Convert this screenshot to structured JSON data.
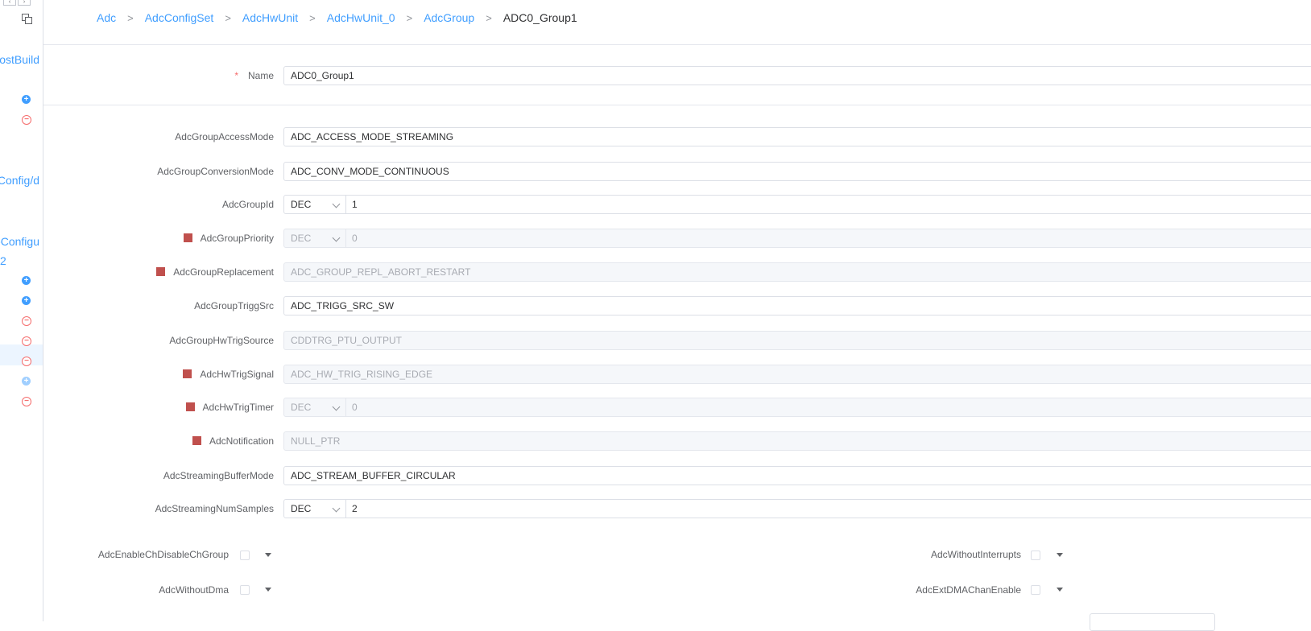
{
  "sidebar": {
    "items": [
      {
        "text": "ostBuild"
      },
      {
        "text": "Config/d"
      },
      {
        "text": "eConfigu"
      },
      {
        "text": "2"
      }
    ]
  },
  "breadcrumb": [
    "Adc",
    "AdcConfigSet",
    "AdcHwUnit",
    "AdcHwUnit_0",
    "AdcGroup",
    "ADC0_Group1"
  ],
  "breadcrumb_separator": ">",
  "form": {
    "name": {
      "label": "Name",
      "required_mark": "*",
      "value": "ADC0_Group1"
    },
    "access_mode": {
      "label": "AdcGroupAccessMode",
      "value": "ADC_ACCESS_MODE_STREAMING"
    },
    "conversion_mode": {
      "label": "AdcGroupConversionMode",
      "value": "ADC_CONV_MODE_CONTINUOUS"
    },
    "group_id": {
      "label": "AdcGroupId",
      "base": "DEC",
      "value": "1"
    },
    "group_priority": {
      "label": "AdcGroupPriority",
      "base": "DEC",
      "value": "0"
    },
    "group_replacement": {
      "label": "AdcGroupReplacement",
      "value": "ADC_GROUP_REPL_ABORT_RESTART"
    },
    "trigg_src": {
      "label": "AdcGroupTriggSrc",
      "value": "ADC_TRIGG_SRC_SW"
    },
    "hw_trig_source": {
      "label": "AdcGroupHwTrigSource",
      "value": "CDDTRG_PTU_OUTPUT"
    },
    "hw_trig_signal": {
      "label": "AdcHwTrigSignal",
      "value": "ADC_HW_TRIG_RISING_EDGE"
    },
    "hw_trig_timer": {
      "label": "AdcHwTrigTimer",
      "base": "DEC",
      "value": "0"
    },
    "notification": {
      "label": "AdcNotification",
      "value": "NULL_PTR"
    },
    "streaming_buffer_mode": {
      "label": "AdcStreamingBufferMode",
      "value": "ADC_STREAM_BUFFER_CIRCULAR"
    },
    "streaming_num_samples": {
      "label": "AdcStreamingNumSamples",
      "base": "DEC",
      "value": "2"
    },
    "enable_ch_disable_ch_group": {
      "label": "AdcEnableChDisableChGroup"
    },
    "without_interrupts": {
      "label": "AdcWithoutInterrupts"
    },
    "without_dma": {
      "label": "AdcWithoutDma"
    },
    "ext_dma_chan_enable": {
      "label": "AdcExtDMAChanEnable"
    }
  },
  "colors": {
    "accent": "#409eff",
    "disabled_marker": "#c0504d",
    "required": "#f56c6c"
  }
}
